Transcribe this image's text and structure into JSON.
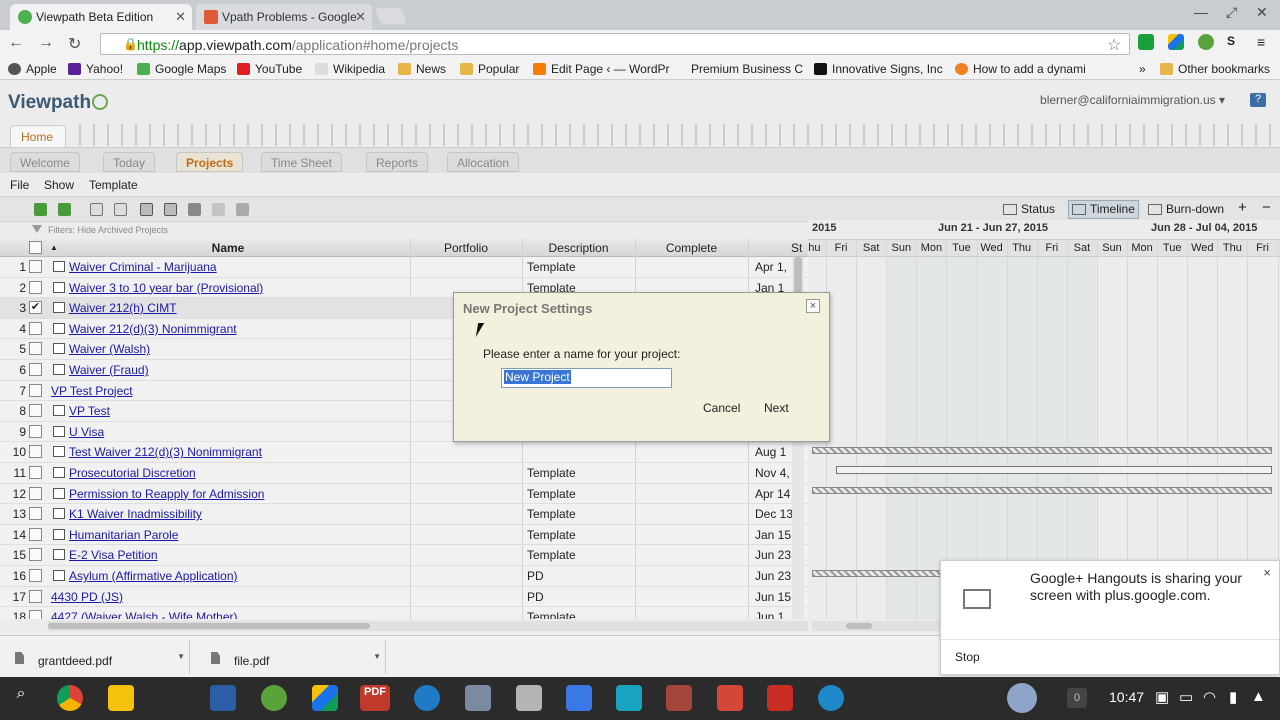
{
  "browser": {
    "tabs": [
      {
        "title": "Viewpath Beta Edition",
        "favicon_color": "#4caf50"
      },
      {
        "title": "Vpath Problems - Google",
        "favicon_color": "#e05a3a"
      }
    ],
    "url": {
      "scheme": "https://",
      "host": "app.viewpath.com",
      "path": "/application#home/projects"
    },
    "bookmarks": [
      {
        "label": "Apple",
        "icon": "apple-icon"
      },
      {
        "label": "Yahoo!",
        "icon": "yahoo-icon"
      },
      {
        "label": "Google Maps",
        "icon": "maps-icon"
      },
      {
        "label": "YouTube",
        "icon": "youtube-icon"
      },
      {
        "label": "Wikipedia",
        "icon": "wikipedia-icon"
      },
      {
        "label": "News",
        "icon": "folder-icon"
      },
      {
        "label": "Popular",
        "icon": "folder-icon"
      },
      {
        "label": "Edit Page ‹ — WordPr",
        "icon": "blogger-icon"
      },
      {
        "label": "Premium Business C",
        "icon": "page-icon"
      },
      {
        "label": "Innovative Signs, Inc",
        "icon": "sign-icon"
      },
      {
        "label": "How to add a dynami",
        "icon": "page-icon"
      },
      {
        "label": "»",
        "icon": ""
      },
      {
        "label": "Other bookmarks",
        "icon": "folder-icon"
      }
    ]
  },
  "app": {
    "logo": "Viewpath",
    "user_email": "blerner@californiaimmigration.us ▾",
    "help": "?",
    "home_tab": "Home",
    "subtabs": [
      "Welcome",
      "Today",
      "Projects",
      "Time Sheet",
      "Reports",
      "Allocation"
    ],
    "active_subtab": "Projects",
    "menu": [
      "File",
      "Show",
      "Template"
    ],
    "view_buttons": [
      "Status",
      "Timeline",
      "Burn-down"
    ],
    "active_view": "Timeline",
    "filter_text": "Filters: Hide Archived Projects",
    "columns": [
      "Name",
      "Portfolio",
      "Description",
      "Complete",
      "St"
    ],
    "rows": [
      {
        "num": "1",
        "checked": false,
        "name": "Waiver Criminal - Marijuana",
        "icon": true,
        "description": "Template",
        "start": "Apr 1,"
      },
      {
        "num": "2",
        "checked": false,
        "name": "Waiver 3 to 10 year bar (Provisional)",
        "icon": true,
        "description": "Template",
        "start": "Jan 1"
      },
      {
        "num": "3",
        "checked": true,
        "name": "Waiver 212(h) CIMT",
        "icon": true,
        "description": "",
        "start": ""
      },
      {
        "num": "4",
        "checked": false,
        "name": "Waiver 212(d)(3) Nonimmigrant",
        "icon": true,
        "description": "",
        "start": ""
      },
      {
        "num": "5",
        "checked": false,
        "name": "Waiver (Walsh)",
        "icon": true,
        "description": "",
        "start": ""
      },
      {
        "num": "6",
        "checked": false,
        "name": "Waiver (Fraud)",
        "icon": true,
        "description": "",
        "start": ""
      },
      {
        "num": "7",
        "checked": false,
        "name": "VP Test Project",
        "icon": false,
        "description": "",
        "start": ""
      },
      {
        "num": "8",
        "checked": false,
        "name": "VP Test",
        "icon": true,
        "description": "",
        "start": ""
      },
      {
        "num": "9",
        "checked": false,
        "name": "U Visa",
        "icon": true,
        "description": "",
        "start": ""
      },
      {
        "num": "10",
        "checked": false,
        "name": "Test Waiver 212(d)(3) Nonimmigrant",
        "icon": true,
        "description": "",
        "start": "Aug 1"
      },
      {
        "num": "11",
        "checked": false,
        "name": "Prosecutorial Discretion",
        "icon": true,
        "description": "Template",
        "start": "Nov 4,"
      },
      {
        "num": "12",
        "checked": false,
        "name": "Permission to Reapply for Admission",
        "icon": true,
        "description": "Template",
        "start": "Apr 14"
      },
      {
        "num": "13",
        "checked": false,
        "name": "K1 Waiver Inadmissibility",
        "icon": true,
        "description": "Template",
        "start": "Dec 13"
      },
      {
        "num": "14",
        "checked": false,
        "name": "Humanitarian Parole",
        "icon": true,
        "description": "Template",
        "start": "Jan 15"
      },
      {
        "num": "15",
        "checked": false,
        "name": "E-2 Visa Petition",
        "icon": true,
        "description": "Template",
        "start": "Jun 23"
      },
      {
        "num": "16",
        "checked": false,
        "name": "Asylum (Affirmative Application)",
        "icon": true,
        "description": "PD",
        "start": "Jun 23"
      },
      {
        "num": "17",
        "checked": false,
        "name": "4430 PD (JS)",
        "icon": false,
        "description": "PD",
        "start": "Jun 15"
      },
      {
        "num": "18",
        "checked": false,
        "name": "4427 (Waiver Walsh - Wife Mother)",
        "icon": false,
        "description": "Template",
        "start": "Jun 1"
      }
    ],
    "timeline": {
      "weeks": [
        "2015",
        "Jun 21 - Jun 27, 2015",
        "Jun 28 - Jul 04, 2015"
      ],
      "days": [
        "Thu",
        "Fri",
        "Sat",
        "Sun",
        "Mon",
        "Tue",
        "Wed",
        "Thu",
        "Fri",
        "Sat",
        "Sun",
        "Mon",
        "Tue",
        "Wed",
        "Thu",
        "Fri"
      ]
    }
  },
  "dialog": {
    "title": "New Project Settings",
    "prompt": "Please enter a name for your project:",
    "input_value": "New Project",
    "cancel": "Cancel",
    "next": "Next",
    "close": "×"
  },
  "downloads": [
    {
      "file": "grantdeed.pdf"
    },
    {
      "file": "file.pdf"
    }
  ],
  "notification": {
    "message": "Google+ Hangouts is sharing your screen with plus.google.com.",
    "stop": "Stop",
    "close": "×"
  },
  "shelf": {
    "time": "10:47",
    "notif_count": "0",
    "pdf_label": "PDF"
  }
}
